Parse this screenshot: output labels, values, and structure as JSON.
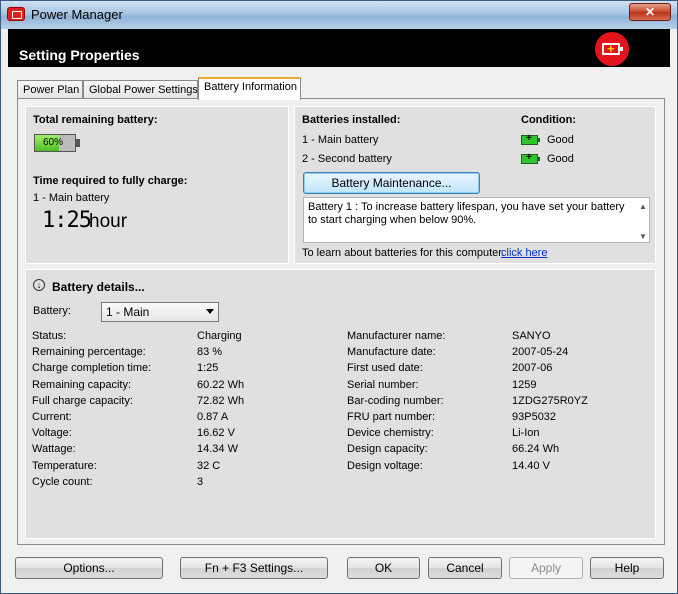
{
  "window": {
    "title": "Power Manager",
    "close_glyph": "✕"
  },
  "header": {
    "title": "Setting Properties",
    "badge_icon": "battery-charging-icon",
    "badge_plus": "+"
  },
  "tabs": [
    {
      "label": "Power Plan"
    },
    {
      "label": "Global Power Settings"
    },
    {
      "label": "Battery Information",
      "active": true
    }
  ],
  "left_panel": {
    "total_label": "Total remaining battery:",
    "battery_percent": "60%",
    "battery_fill": 0.6,
    "time_label": "Time required to fully charge:",
    "time_battery": "1 - Main battery",
    "time_value": "1:25",
    "time_unit": "hour"
  },
  "right_panel": {
    "installed_label": "Batteries installed:",
    "condition_label": "Condition:",
    "batteries": [
      {
        "name": "1 - Main battery",
        "condition": "Good"
      },
      {
        "name": "2 - Second battery",
        "condition": "Good"
      }
    ],
    "maintenance_button": "Battery Maintenance...",
    "memo_text": "Battery 1 : To increase battery lifespan, you have set your battery to start charging when below 90%.",
    "learn_text": "To learn about batteries for this computer.",
    "learn_link": "click here"
  },
  "details": {
    "title": "Battery details...",
    "battery_label": "Battery:",
    "battery_selected": "1 - Main",
    "left_rows": [
      {
        "label": "Status:",
        "value": "Charging"
      },
      {
        "label": "Remaining percentage:",
        "value": "83 %"
      },
      {
        "label": "Charge completion time:",
        "value": "1:25"
      },
      {
        "label": "Remaining capacity:",
        "value": "60.22 Wh"
      },
      {
        "label": "Full charge capacity:",
        "value": "72.82 Wh"
      },
      {
        "label": "Current:",
        "value": "0.87 A"
      },
      {
        "label": "Voltage:",
        "value": "16.62 V"
      },
      {
        "label": "Wattage:",
        "value": "14.34 W"
      },
      {
        "label": "Temperature:",
        "value": "32 C"
      },
      {
        "label": "Cycle count:",
        "value": "3"
      }
    ],
    "right_rows": [
      {
        "label": "Manufacturer name:",
        "value": "SANYO"
      },
      {
        "label": "Manufacture date:",
        "value": "2007-05-24"
      },
      {
        "label": "First used date:",
        "value": "2007-06"
      },
      {
        "label": "Serial number:",
        "value": "1259"
      },
      {
        "label": "Bar-coding number:",
        "value": "1ZDG275R0YZ"
      },
      {
        "label": "FRU part number:",
        "value": "93P5032"
      },
      {
        "label": "Device chemistry:",
        "value": "Li-Ion"
      },
      {
        "label": "Design capacity:",
        "value": "66.24 Wh"
      },
      {
        "label": "Design voltage:",
        "value": "14.40 V"
      }
    ]
  },
  "footer": {
    "options": "Options...",
    "fn_f3": "Fn + F3 Settings...",
    "ok": "OK",
    "cancel": "Cancel",
    "apply": "Apply",
    "help": "Help"
  }
}
